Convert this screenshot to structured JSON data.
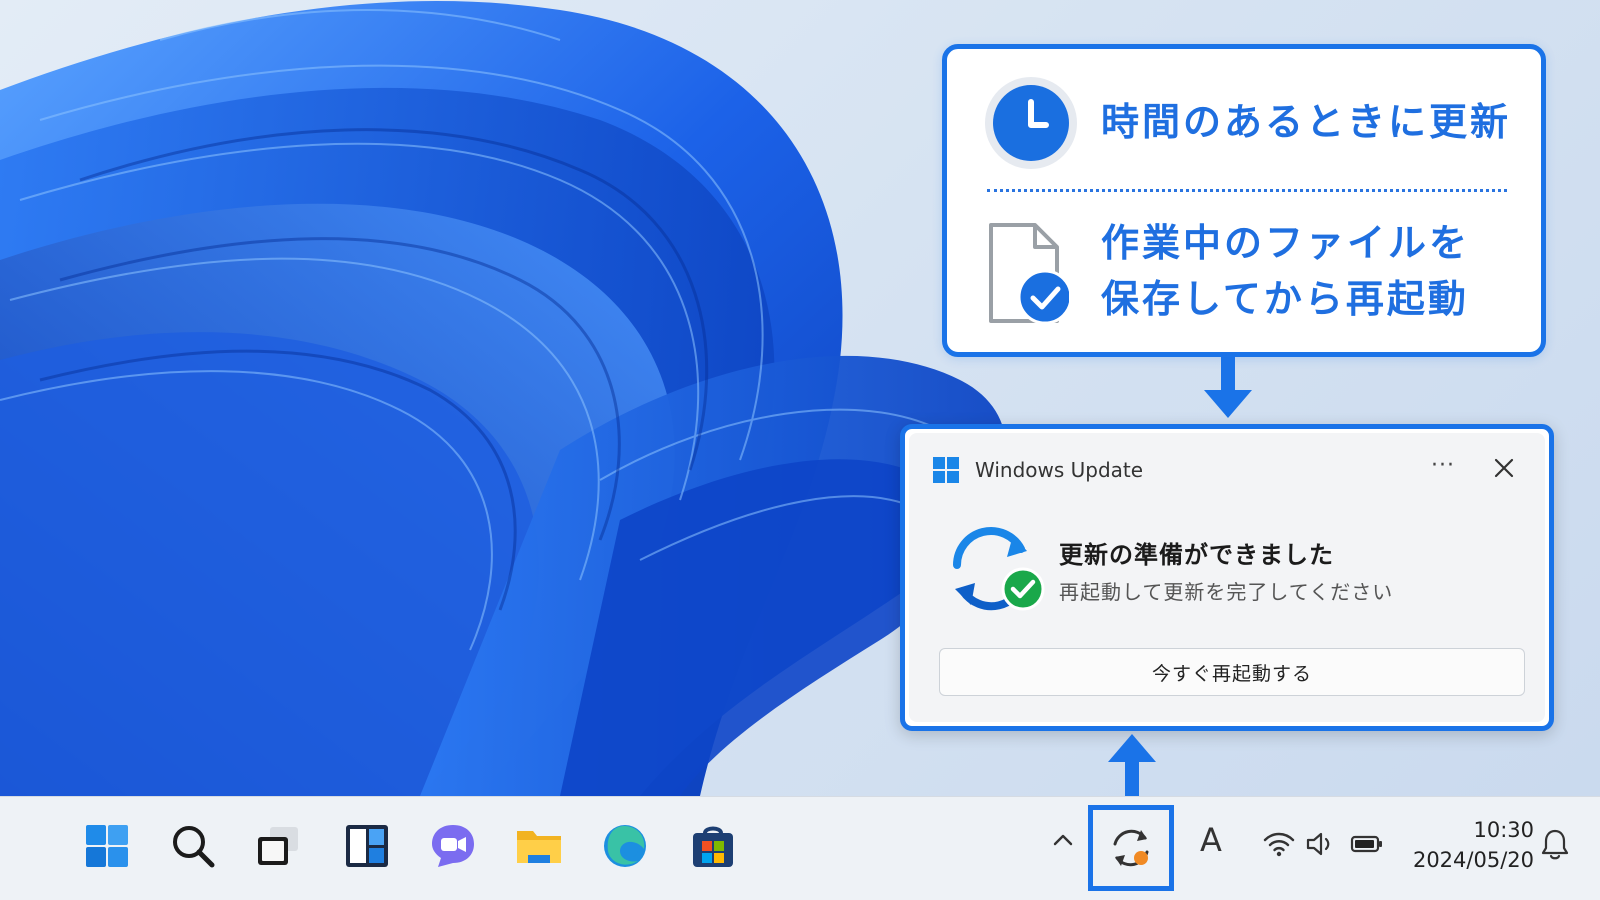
{
  "callout": {
    "tip_time": "時間のあるときに更新",
    "tip_save_line1": "作業中のファイルを",
    "tip_save_line2": "保存してから再起動",
    "icons": [
      "clock-icon",
      "file-check-icon"
    ]
  },
  "toast": {
    "app_name": "Windows Update",
    "more_label": "···",
    "title": "更新の準備ができました",
    "body": "再起動して更新を完了してください",
    "restart_button": "今すぐ再起動する",
    "icons": [
      "windows-logo-icon",
      "more-icon",
      "close-icon",
      "update-check-icon"
    ]
  },
  "taskbar": {
    "pinned": [
      "start-icon",
      "search-icon",
      "task-view-icon",
      "widgets-icon",
      "teams-chat-icon",
      "file-explorer-icon",
      "edge-icon",
      "store-icon"
    ],
    "tray": {
      "ime_label": "A",
      "time": "10:30",
      "date": "2024/05/20",
      "icons": [
        "chevron-up-icon",
        "update-pending-icon",
        "wifi-icon",
        "volume-icon",
        "battery-icon",
        "bell-icon"
      ]
    }
  },
  "colors": {
    "accent": "#1a73e8",
    "callout_text": "#1f6fe0",
    "success": "#1aa84a",
    "update_dot": "#f08a24"
  }
}
